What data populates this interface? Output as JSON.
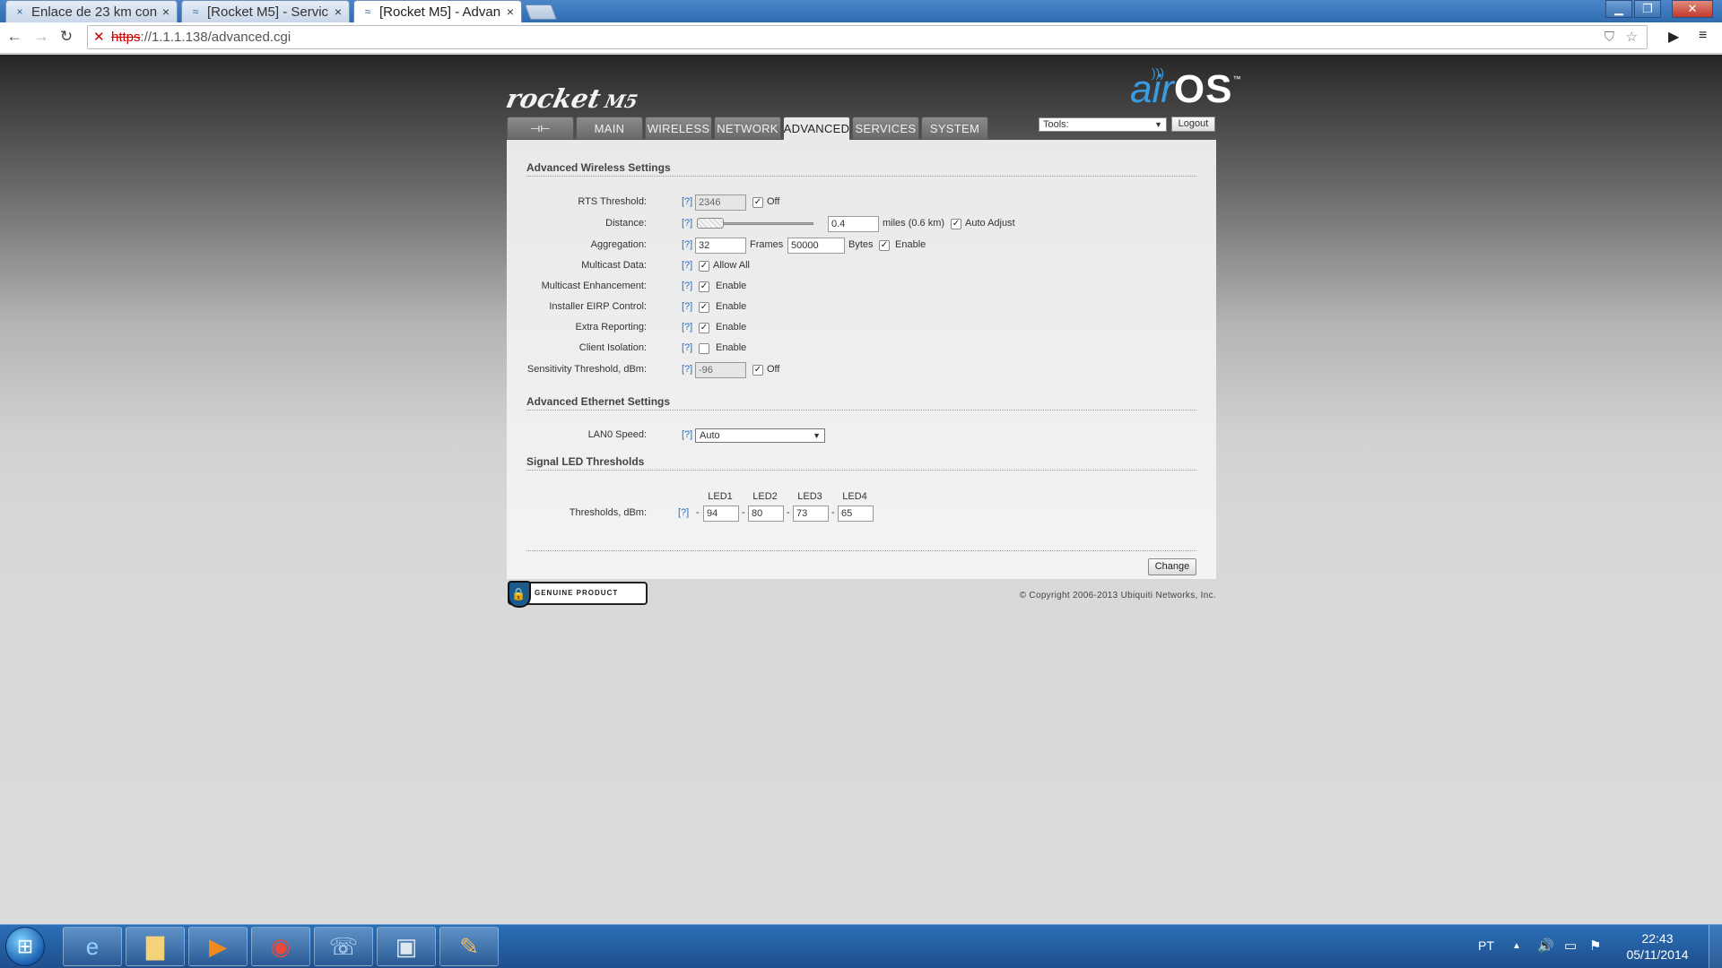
{
  "browser": {
    "tabs": [
      {
        "title": "Enlace de 23 km con",
        "icon": "×",
        "active": false
      },
      {
        "title": "[Rocket M5] - Servic",
        "icon": "≈",
        "active": false
      },
      {
        "title": "[Rocket M5] - Advan",
        "icon": "≈",
        "active": true
      }
    ],
    "url_scheme": "https",
    "url_rest": "://1.1.1.138/advanced.cgi"
  },
  "header": {
    "product_name": "rocket",
    "product_model": "M5",
    "brand_air": "air",
    "brand_os": "OS",
    "brand_tm": "™",
    "nav_tabs": [
      "MAIN",
      "WIRELESS",
      "NETWORK",
      "ADVANCED",
      "SERVICES",
      "SYSTEM"
    ],
    "active_tab": "ADVANCED",
    "tools_label": "Tools:",
    "logout_label": "Logout"
  },
  "wireless": {
    "section_title": "Advanced Wireless Settings",
    "help": "[?]",
    "rts_label": "RTS Threshold:",
    "rts_value": "2346",
    "rts_off": "Off",
    "distance_label": "Distance:",
    "distance_value": "0.4",
    "distance_units": "miles (0.6 km)",
    "auto_adjust": "Auto Adjust",
    "aggregation_label": "Aggregation:",
    "agg_frames_value": "32",
    "agg_frames_unit": "Frames",
    "agg_bytes_value": "50000",
    "agg_bytes_unit": "Bytes",
    "agg_enable": "Enable",
    "multicast_label": "Multicast Data:",
    "multicast_opt": "Allow All",
    "mcast_enh_label": "Multicast Enhancement:",
    "installer_eirp_label": "Installer EIRP Control:",
    "extra_reporting_label": "Extra Reporting:",
    "client_isolation_label": "Client Isolation:",
    "enable": "Enable",
    "sensitivity_label": "Sensitivity Threshold, dBm:",
    "sensitivity_value": "-96",
    "sensitivity_off": "Off"
  },
  "ethernet": {
    "section_title": "Advanced Ethernet Settings",
    "lan0_label": "LAN0 Speed:",
    "lan0_value": "Auto"
  },
  "led": {
    "section_title": "Signal LED Thresholds",
    "headers": [
      "LED1",
      "LED2",
      "LED3",
      "LED4"
    ],
    "thresholds_label": "Thresholds, dBm:",
    "values": [
      "94",
      "80",
      "73",
      "65"
    ],
    "dash": "-"
  },
  "actions": {
    "change_label": "Change"
  },
  "footer": {
    "genuine_text": "GENUINE PRODUCT",
    "copyright": "© Copyright 2006-2013 Ubiquiti Networks, Inc."
  },
  "taskbar": {
    "language": "PT",
    "time": "22:43",
    "date": "05/11/2014"
  }
}
